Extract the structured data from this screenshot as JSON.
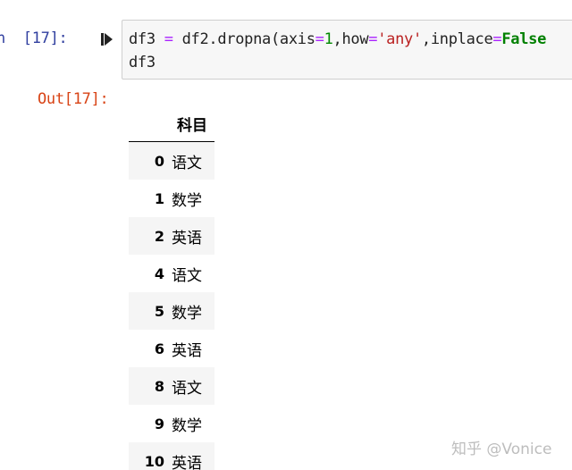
{
  "input_cell": {
    "prompt": "n  [17]:",
    "code_lines": [
      {
        "tokens": [
          {
            "text": "df3 ",
            "cls": ""
          },
          {
            "text": "=",
            "cls": "tok-op"
          },
          {
            "text": " df2.dropna(axis",
            "cls": ""
          },
          {
            "text": "=",
            "cls": "tok-op"
          },
          {
            "text": "1",
            "cls": "tok-num"
          },
          {
            "text": ",how",
            "cls": ""
          },
          {
            "text": "=",
            "cls": "tok-op"
          },
          {
            "text": "'any'",
            "cls": "tok-str"
          },
          {
            "text": ",inplace",
            "cls": ""
          },
          {
            "text": "=",
            "cls": "tok-op"
          },
          {
            "text": "False",
            "cls": "tok-kw"
          }
        ]
      },
      {
        "tokens": [
          {
            "text": "df3",
            "cls": ""
          }
        ]
      }
    ]
  },
  "output_cell": {
    "prompt": "Out[17]:",
    "dataframe": {
      "column_header": "科目",
      "rows": [
        {
          "index": "0",
          "value": "语文"
        },
        {
          "index": "1",
          "value": "数学"
        },
        {
          "index": "2",
          "value": "英语"
        },
        {
          "index": "4",
          "value": "语文"
        },
        {
          "index": "5",
          "value": "数学"
        },
        {
          "index": "6",
          "value": "英语"
        },
        {
          "index": "8",
          "value": "语文"
        },
        {
          "index": "9",
          "value": "数学"
        },
        {
          "index": "10",
          "value": "英语"
        }
      ]
    }
  },
  "icons": {
    "run_cell": "run-cell-icon"
  },
  "colors": {
    "input_prompt": "#303f9f",
    "output_prompt": "#d84315",
    "cell_background": "#f7f7f7",
    "striped_row": "#f5f5f5"
  },
  "watermark": "知乎 @Vonice"
}
